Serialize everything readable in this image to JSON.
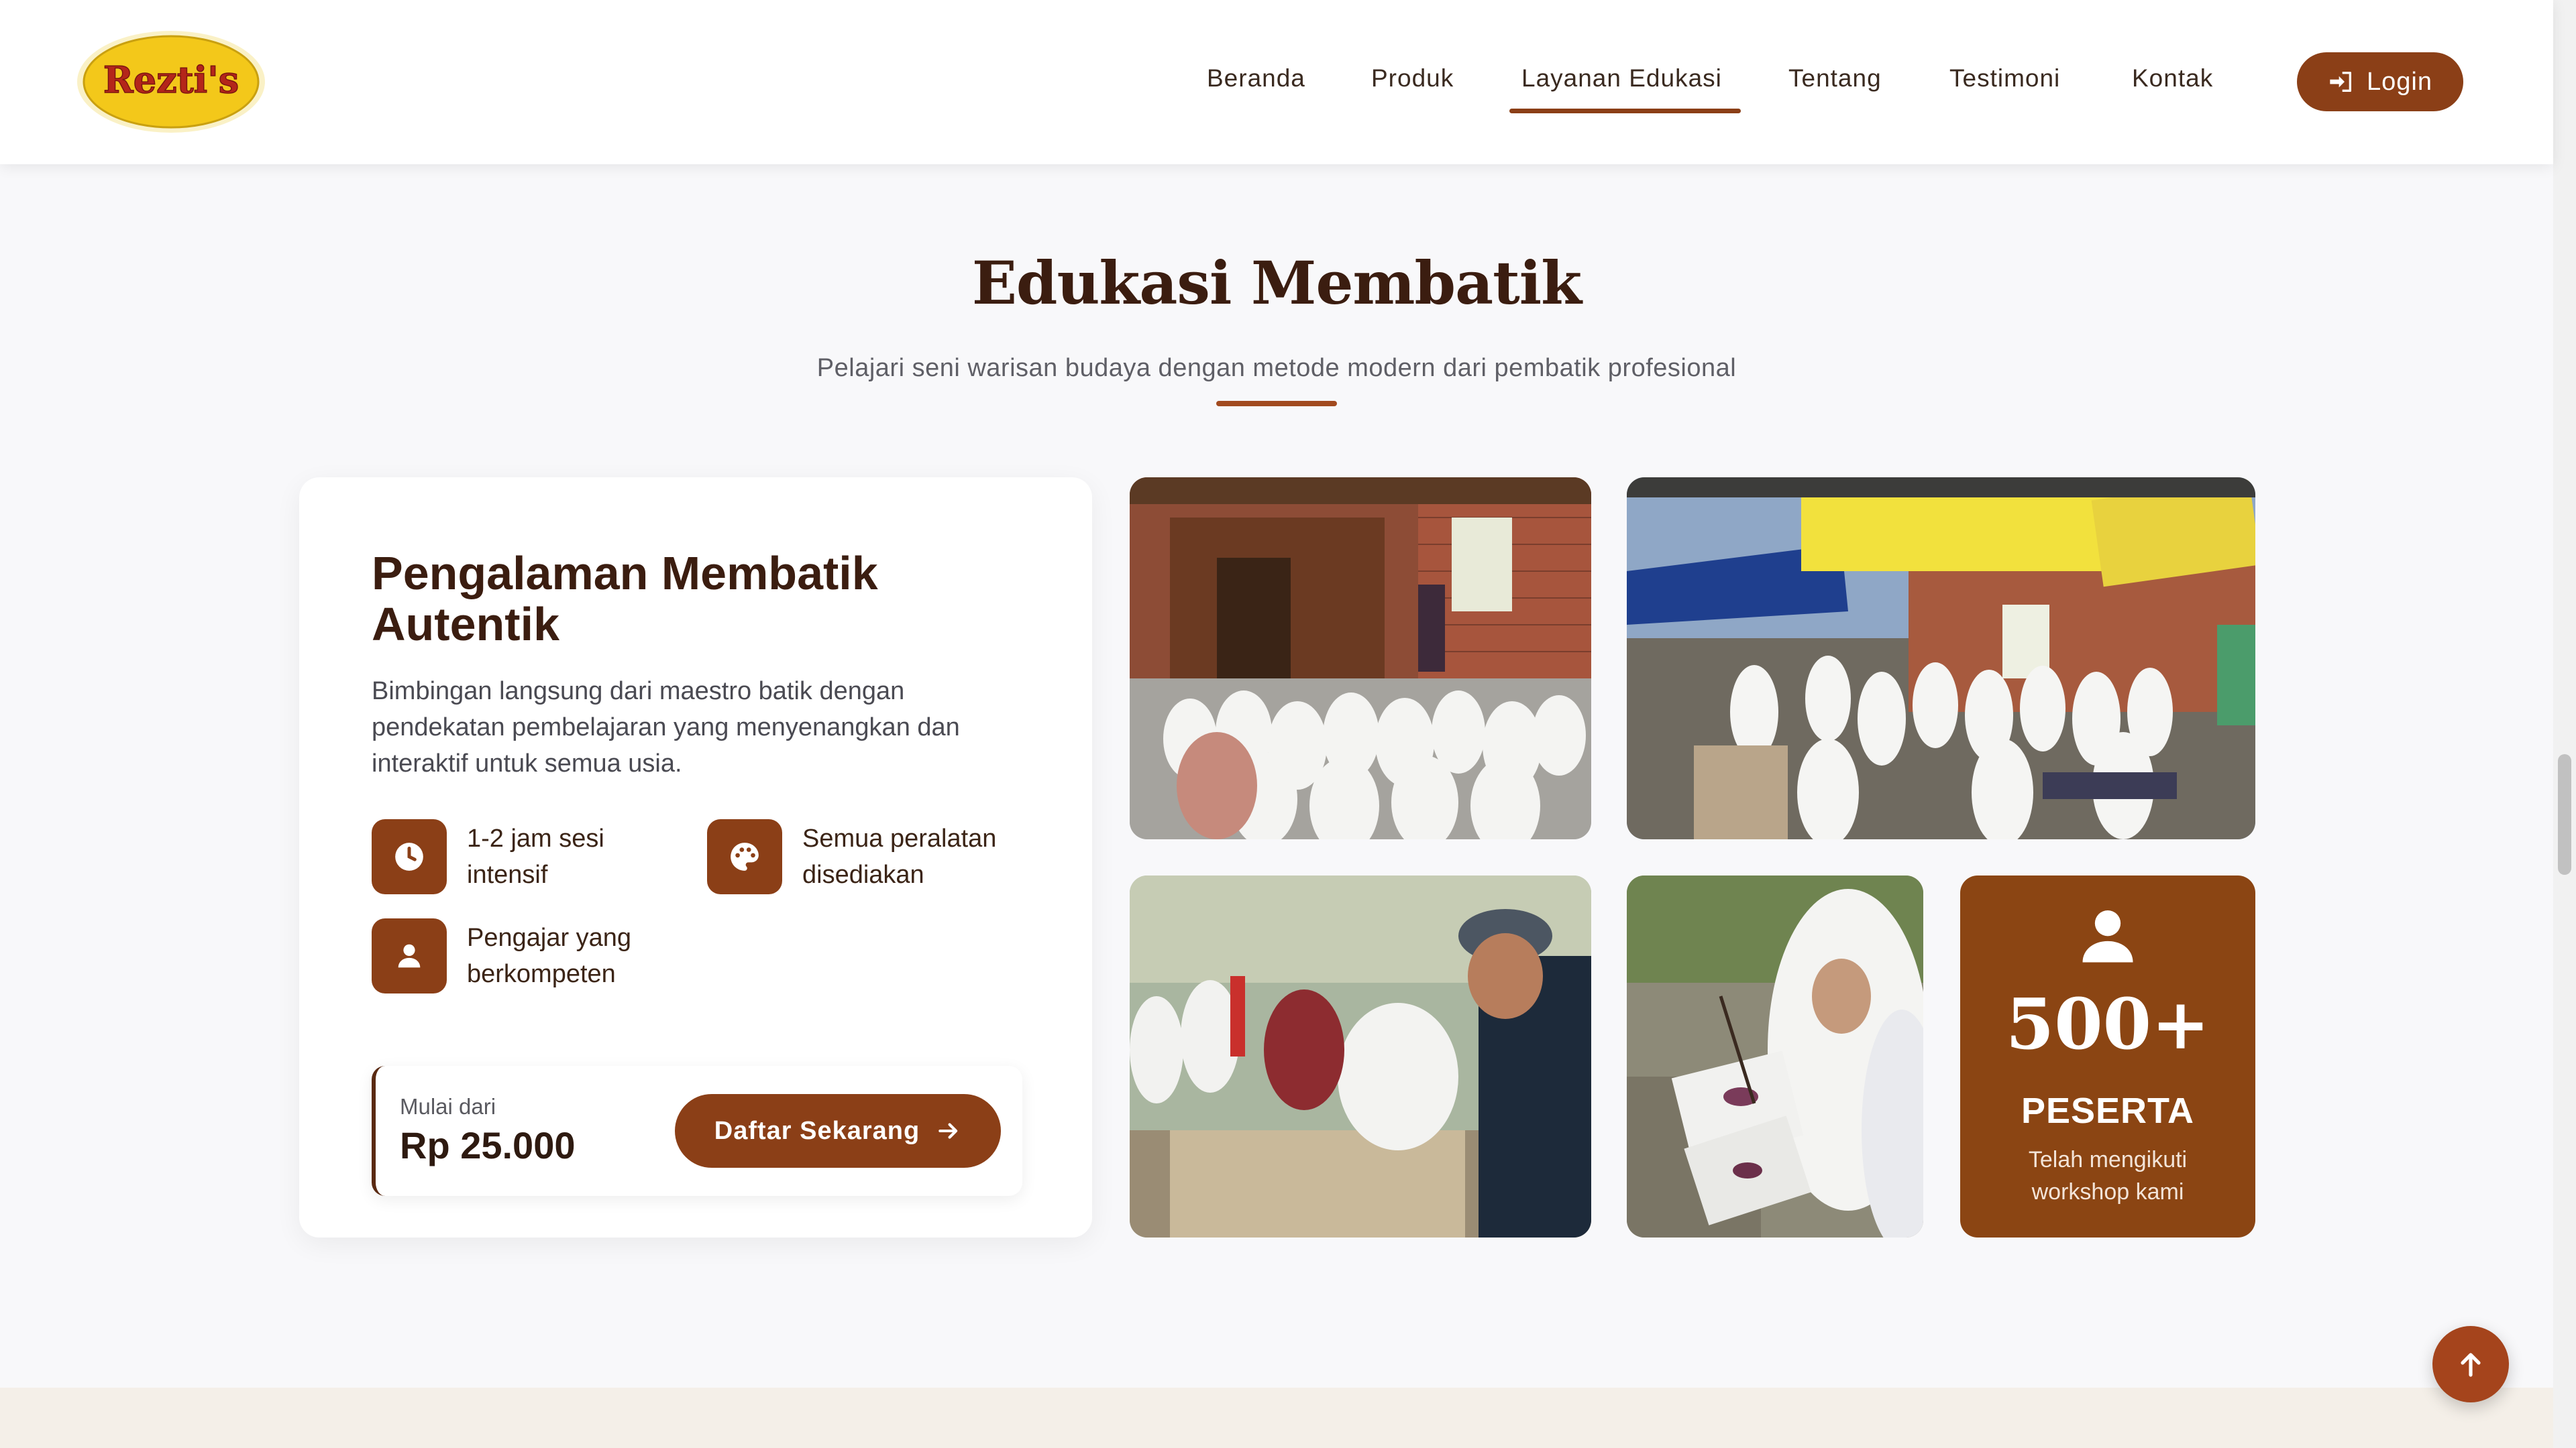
{
  "header": {
    "logo_text": "Rezti's",
    "nav": [
      {
        "label": "Beranda",
        "active": false
      },
      {
        "label": "Produk",
        "active": false
      },
      {
        "label": "Layanan Edukasi",
        "active": true
      },
      {
        "label": "Tentang",
        "active": false
      },
      {
        "label": "Testimoni",
        "active": false
      },
      {
        "label": "Kontak",
        "active": false
      }
    ],
    "login_label": "Login"
  },
  "section": {
    "title": "Edukasi Membatik",
    "subtitle": "Pelajari seni warisan budaya dengan metode modern dari pembatik profesional"
  },
  "card": {
    "title": "Pengalaman Membatik Autentik",
    "description": "Bimbingan langsung dari maestro batik dengan pendekatan pembelajaran yang menyenangkan dan interaktif untuk semua usia.",
    "features": [
      {
        "icon": "clock-icon",
        "label": "1-2 jam sesi intensif"
      },
      {
        "icon": "palette-icon",
        "label": "Semua peralatan disediakan"
      },
      {
        "icon": "user-icon",
        "label": "Pengajar yang berkompeten"
      }
    ],
    "price_label": "Mulai dari",
    "price_value": "Rp 25.000",
    "cta_label": "Daftar Sekarang"
  },
  "gallery": {
    "stat_number": "500+",
    "stat_label": "PESERTA",
    "stat_desc": "Telah mengikuti workshop kami"
  },
  "colors": {
    "brand": "#8b3f17",
    "stat_bg": "#8b4513",
    "title": "#3b1d10"
  }
}
